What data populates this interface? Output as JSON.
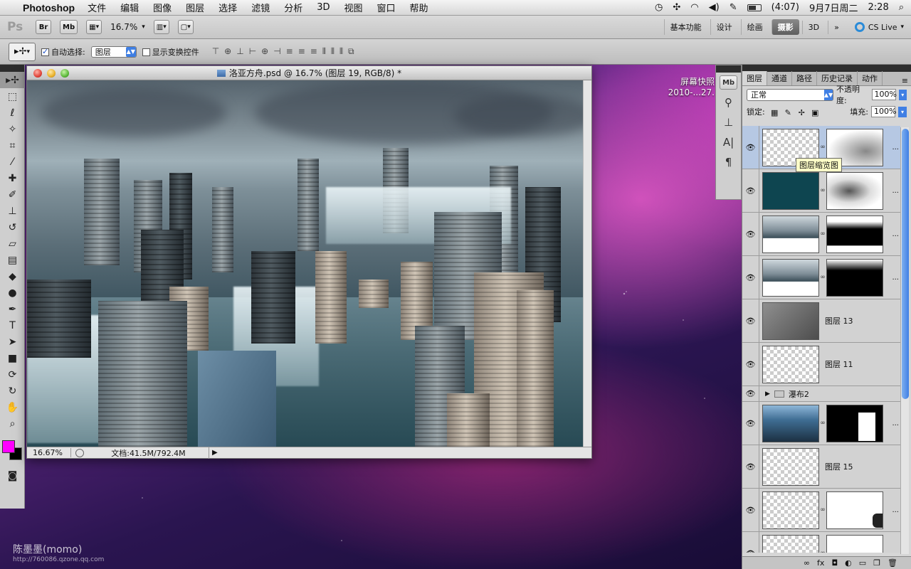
{
  "menubar": {
    "app_name": "Photoshop",
    "items": [
      "文件",
      "编辑",
      "图像",
      "图层",
      "选择",
      "滤镜",
      "分析",
      "3D",
      "视图",
      "窗口",
      "帮助"
    ],
    "battery": "(4:07)",
    "date": "9月7日周二",
    "time": "2:28"
  },
  "appbar": {
    "logo": "Ps",
    "br": "Br",
    "mb": "Mb",
    "zoom": "16.7%",
    "workspaces": [
      "基本功能",
      "设计",
      "绘画",
      "摄影",
      "3D"
    ],
    "active_workspace": "摄影",
    "cs_live": "CS Live"
  },
  "options": {
    "auto_select_label": "自动选择:",
    "auto_select_value": "图层",
    "show_transform_label": "显示变换控件"
  },
  "document": {
    "title": "洛亚方舟.psd @ 16.7% (图层 19, RGB/8) *",
    "zoom": "16.67%",
    "doc_size": "文档:41.5M/792.4M"
  },
  "desktop": {
    "screenshot_name": "屏幕快照",
    "screenshot_date": "2010-...27.",
    "watermark": "陈墨墨(momo)",
    "watermark_url": "http://760086.qzone.qq.com"
  },
  "minidock": {
    "mb": "Mb"
  },
  "layers_panel": {
    "tabs": [
      "图层",
      "通道",
      "路径",
      "历史记录",
      "动作"
    ],
    "active_tab": "图层",
    "blend_mode": "正常",
    "opacity_label": "不透明度:",
    "opacity": "100%",
    "lock_label": "锁定:",
    "fill_label": "填充:",
    "fill": "100%",
    "tooltip": "图层缩览图",
    "layers": [
      {
        "name": "",
        "has_mask": true,
        "selected": true
      },
      {
        "name": "",
        "has_mask": true,
        "selected": false
      },
      {
        "name": "",
        "has_mask": true,
        "selected": false
      },
      {
        "name": "",
        "has_mask": true,
        "selected": false
      },
      {
        "name": "图层 13",
        "has_mask": false,
        "selected": false
      },
      {
        "name": "图层 11",
        "has_mask": false,
        "selected": false
      },
      {
        "group": "瀑布2"
      },
      {
        "name": "",
        "has_mask": true,
        "selected": false
      },
      {
        "name": "图层 15",
        "has_mask": false,
        "selected": false
      },
      {
        "name": "",
        "has_mask": true,
        "selected": false
      },
      {
        "name": "",
        "has_mask": true,
        "selected": false
      }
    ]
  },
  "colors": {
    "foreground": "#ff00ff",
    "background": "#000000",
    "accent": "#3f7fe4"
  }
}
